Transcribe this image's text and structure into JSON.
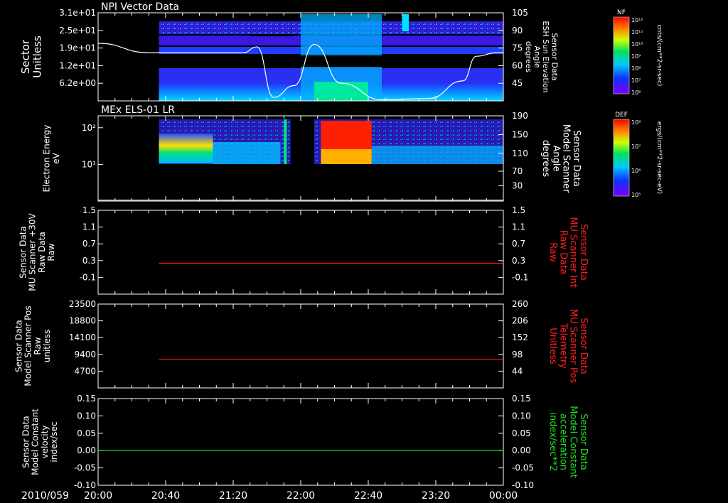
{
  "date_label": "2010/059",
  "time_ticks": [
    "20:00",
    "20:40",
    "21:20",
    "22:00",
    "22:40",
    "23:20",
    "00:00"
  ],
  "colors": {
    "background": "#000000",
    "axis": "#ffffff",
    "red_trace": "#ff2020",
    "green_trace": "#22dd22"
  },
  "chart_data": [
    {
      "type": "heatmap",
      "title": "NPI Vector Data",
      "ylabel": "Sector\nUnitless",
      "yticks": [
        "3.1e+01",
        "2.5e+01",
        "1.9e+01",
        "1.2e+01",
        "6.2e+00"
      ],
      "y2label": "Sensor Data\nESH Sun Elevation\nAngle\ndegrees",
      "y2ticks": [
        "105",
        "90",
        "75",
        "60",
        "45"
      ],
      "y2lim": [
        30,
        105
      ],
      "overlay_line": {
        "name": "ESH Sun Elevation Angle",
        "x": [
          "20:00",
          "20:30",
          "21:10",
          "21:26",
          "21:34",
          "21:44",
          "21:56",
          "22:08",
          "22:24",
          "22:48",
          "23:16",
          "23:36",
          "23:44",
          "23:56",
          "00:00"
        ],
        "y": [
          79,
          71,
          71,
          71,
          76,
          33,
          43,
          78,
          45,
          31,
          32,
          47,
          68,
          71,
          71
        ]
      },
      "colorbar": {
        "label": "NF",
        "unit": "cnts/(cm**2-sr-sec)",
        "ticks": [
          "10¹²",
          "10¹¹",
          "10¹⁰",
          "10⁹",
          "10⁸",
          "10⁷",
          "10⁶"
        ]
      }
    },
    {
      "type": "heatmap",
      "title": "MEx ELS-01 LR",
      "ylabel": "Electron Energy\neV",
      "yticks": [
        "10²",
        "10¹"
      ],
      "y2label": "Sensor Data\nModel Scanner\nAngle\ndegrees",
      "y2ticks": [
        "190",
        "150",
        "110",
        "70",
        "30"
      ],
      "y2lim": [
        10,
        190
      ],
      "overlay_line": {
        "name": "Model Scanner Angle",
        "x": [
          "20:00",
          "00:00"
        ],
        "y": [
          12,
          12
        ]
      },
      "colorbar": {
        "label": "DEF",
        "unit": "ergs/(cm**2-sr-sec-eV)",
        "ticks": [
          "10⁸",
          "10⁷",
          "10⁶",
          "10⁵"
        ]
      }
    },
    {
      "type": "line",
      "ylabel": "Sensor Data\nMU Scanner +30V\nRaw Data\nRaw",
      "yticks": [
        "1.5",
        "1.1",
        "0.7",
        "0.3",
        "-0.1"
      ],
      "ylim": [
        -0.5,
        1.5
      ],
      "y2label": "Sensor Data\nMU Scanner Int\nRaw Data\nRaw",
      "y2ticks": [
        "1.5",
        "1.1",
        "0.7",
        "0.3",
        "-0.1"
      ],
      "series": [
        {
          "x": [
            "20:36",
            "00:00"
          ],
          "y": [
            0.0,
            0.0
          ]
        }
      ]
    },
    {
      "type": "line",
      "ylabel": "Sensor Data\nModel Scanner Pos\nRaw\nunitless",
      "yticks": [
        "23500",
        "18800",
        "14100",
        "9400",
        "4700"
      ],
      "ylim": [
        0,
        23500
      ],
      "y2label": "Sensor Data\nMU Scanner Pos\nTelemetry\nUnitless",
      "y2ticks": [
        "260",
        "206",
        "152",
        "98",
        "44"
      ],
      "series": [
        {
          "x": [
            "20:36",
            "00:00"
          ],
          "y": [
            8000,
            8000
          ]
        }
      ]
    },
    {
      "type": "line",
      "ylabel": "Sensor Data\nModel Constant\nvelocity\nindex/sec",
      "yticks": [
        "0.15",
        "0.10",
        "0.05",
        "0.00",
        "-0.05",
        "-0.10"
      ],
      "ylim": [
        -0.1,
        0.15
      ],
      "y2label": "Sensor Data\nModel Constant\nacceleration\nindex/sec**2",
      "y2ticks": [
        "0.15",
        "0.10",
        "0.05",
        "0.00",
        "-0.05",
        "-0.10"
      ],
      "series": [
        {
          "x": [
            "20:00",
            "00:00"
          ],
          "y": [
            0.0,
            0.0
          ]
        }
      ]
    }
  ]
}
